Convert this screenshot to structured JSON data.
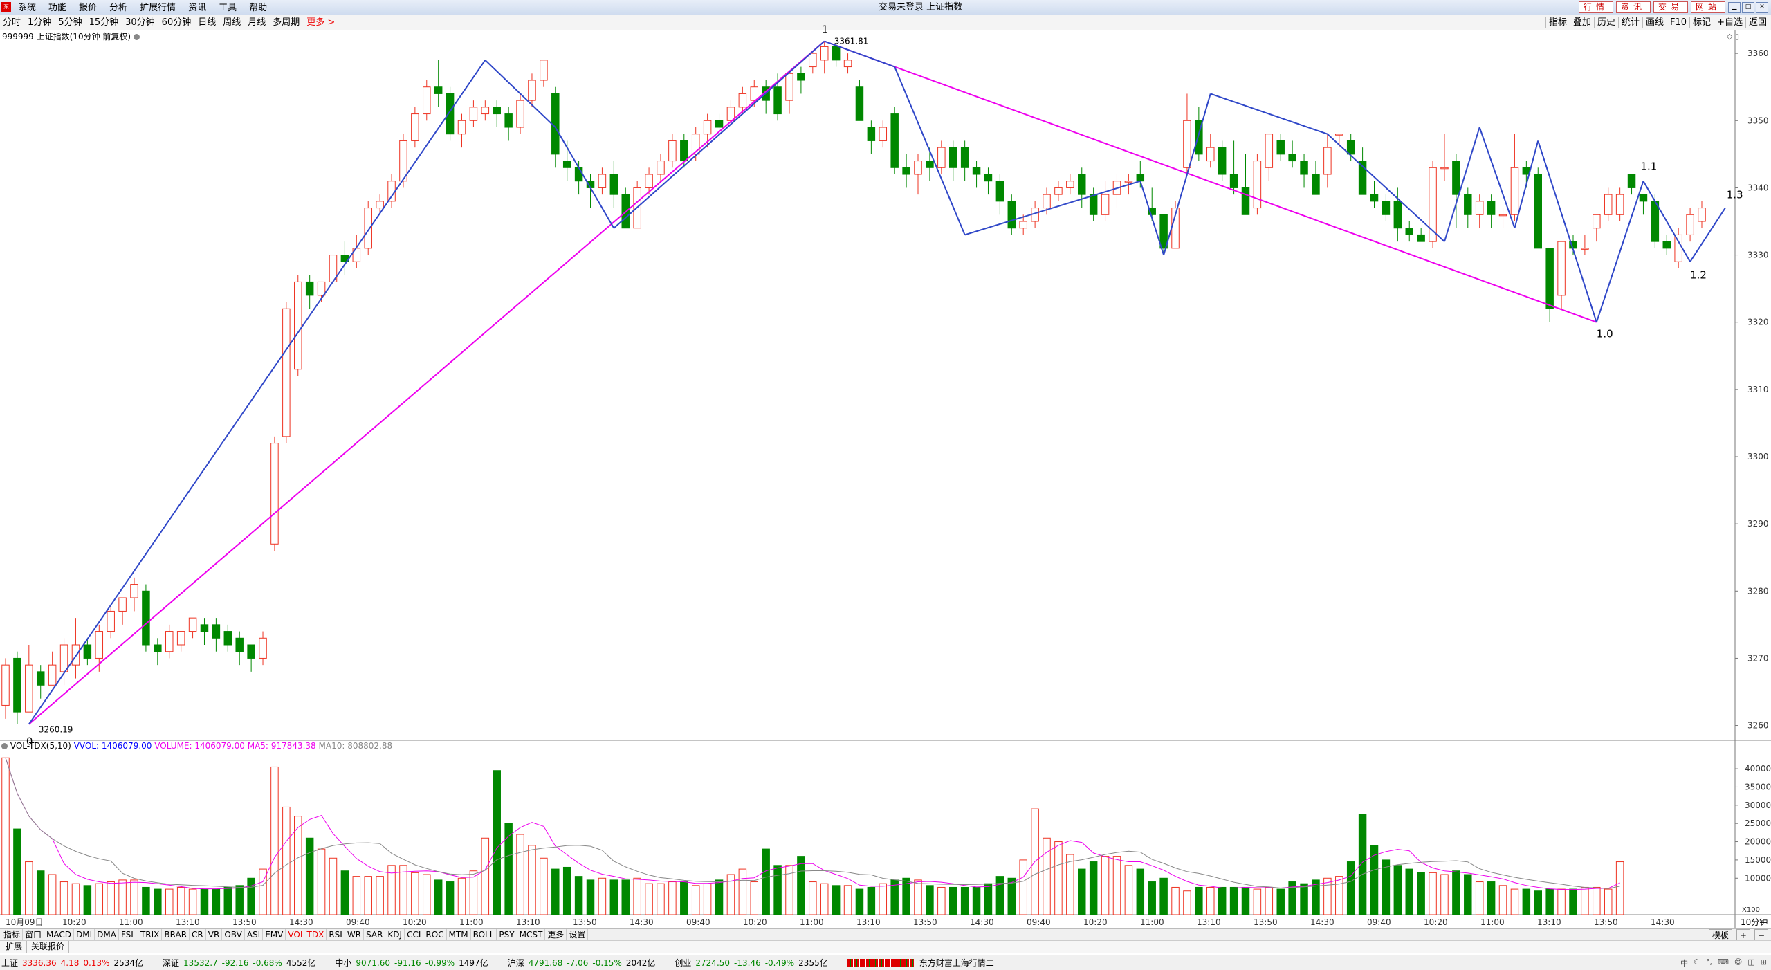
{
  "titlebar": {
    "menu": [
      "系统",
      "功能",
      "报价",
      "分析",
      "扩展行情",
      "资讯",
      "工具",
      "帮助"
    ],
    "title": "交易未登录 上证指数",
    "right_buttons": [
      "行情",
      "资讯",
      "交易",
      "网站"
    ]
  },
  "periodbar": {
    "items": [
      "分时",
      "1分钟",
      "5分钟",
      "15分钟",
      "30分钟",
      "60分钟",
      "日线",
      "周线",
      "月线",
      "多周期"
    ],
    "more": "更多 >",
    "right": [
      "指标",
      "叠加",
      "历史",
      "统计",
      "画线",
      "F10",
      "标记",
      "+自选",
      "返回"
    ]
  },
  "chart": {
    "header": "999999 上证指数(10分钟 前复权)",
    "period_label": "10分钟",
    "low_label": "3260.19",
    "high_label": "3361.81",
    "wave_labels": [
      "0",
      "1",
      "1.0",
      "1.1",
      "1.2",
      "1.3"
    ]
  },
  "indicator": {
    "name": "VOL-TDX(5,10)",
    "vvol": "VVOL: 1406079.00",
    "volume": "VOLUME: 1406079.00",
    "ma5": "MA5: 917843.38",
    "ma10": "MA10: 808802.88",
    "scale_unit": "X100"
  },
  "indbar": {
    "items": [
      "指标",
      "窗口",
      "MACD",
      "DMI",
      "DMA",
      "FSL",
      "TRIX",
      "BRAR",
      "CR",
      "VR",
      "OBV",
      "ASI",
      "EMV",
      "VOL-TDX",
      "RSI",
      "WR",
      "SAR",
      "KDJ",
      "CCI",
      "ROC",
      "MTM",
      "BOLL",
      "PSY",
      "MCST",
      "更多",
      "设置"
    ],
    "selected": "VOL-TDX",
    "right": [
      "模板",
      "+",
      "−"
    ]
  },
  "tabbar": {
    "items": [
      "扩展",
      "关联报价"
    ]
  },
  "statusbar": {
    "groups": [
      {
        "name": "上证",
        "value": "3336.36",
        "change": "4.18",
        "pct": "0.13%",
        "amount": "2534亿",
        "dir": "up"
      },
      {
        "name": "深证",
        "value": "13532.7",
        "change": "-92.16",
        "pct": "-0.68%",
        "amount": "4552亿",
        "dir": "down"
      },
      {
        "name": "中小",
        "value": "9071.60",
        "change": "-91.16",
        "pct": "-0.99%",
        "amount": "1497亿",
        "dir": "down"
      },
      {
        "name": "沪深",
        "value": "4791.68",
        "change": "-7.06",
        "pct": "-0.15%",
        "amount": "2042亿",
        "dir": "down"
      },
      {
        "name": "创业",
        "value": "2724.50",
        "change": "-13.46",
        "pct": "-0.49%",
        "amount": "2355亿",
        "dir": "down"
      }
    ],
    "marquee": "东方财富上海行情二",
    "input_mode": "中"
  },
  "chart_data": {
    "type": "candlestick",
    "y_axis": {
      "ticks": [
        3260,
        3270,
        3280,
        3290,
        3300,
        3310,
        3320,
        3330,
        3340,
        3350,
        3360
      ],
      "range": [
        3258,
        3363
      ]
    },
    "x_axis": {
      "ticks": [
        "10月09日",
        "10:20",
        "11:00",
        "13:10",
        "13:50",
        "14:30",
        "09:40",
        "10:20",
        "11:00",
        "13:10",
        "13:50",
        "14:30",
        "09:40",
        "10:20",
        "11:00",
        "13:10",
        "13:50",
        "14:30",
        "09:40",
        "10:20",
        "11:00",
        "13:10",
        "13:50",
        "14:30",
        "09:40",
        "10:20",
        "11:00",
        "13:10",
        "13:50",
        "14:30"
      ]
    },
    "candles": [
      [
        3263,
        3269,
        3261,
        3270
      ],
      [
        3270,
        3262,
        3260.19,
        3271
      ],
      [
        3262,
        3269,
        3262,
        3272
      ],
      [
        3268,
        3266,
        3264,
        3269
      ],
      [
        3266,
        3269,
        3266,
        3271
      ],
      [
        3268,
        3272,
        3266,
        3273
      ],
      [
        3269,
        3272,
        3267,
        3276
      ],
      [
        3272,
        3270,
        3269,
        3273
      ],
      [
        3270,
        3274,
        3268,
        3275
      ],
      [
        3274,
        3277,
        3273,
        3278
      ],
      [
        3277,
        3279,
        3275,
        3279
      ],
      [
        3279,
        3281,
        3277,
        3282
      ],
      [
        3280,
        3272,
        3271,
        3281
      ],
      [
        3272,
        3271,
        3269,
        3273
      ],
      [
        3271,
        3274,
        3270,
        3275
      ],
      [
        3272,
        3274,
        3271,
        3274
      ],
      [
        3274,
        3276,
        3273,
        3276
      ],
      [
        3275,
        3274,
        3272,
        3276
      ],
      [
        3275,
        3273,
        3271,
        3276
      ],
      [
        3274,
        3272,
        3271,
        3275
      ],
      [
        3273,
        3271,
        3269,
        3274
      ],
      [
        3272,
        3270,
        3268,
        3272
      ],
      [
        3270,
        3273,
        3269,
        3274
      ],
      [
        3287,
        3302,
        3286,
        3303
      ],
      [
        3303,
        3322,
        3302,
        3323
      ],
      [
        3313,
        3326,
        3312,
        3327
      ],
      [
        3326,
        3324,
        3322,
        3327
      ],
      [
        3324,
        3326,
        3323,
        3326
      ],
      [
        3326,
        3330,
        3325,
        3331
      ],
      [
        3330,
        3329,
        3327,
        3332
      ],
      [
        3329,
        3331,
        3328,
        3333
      ],
      [
        3331,
        3337,
        3330,
        3338
      ],
      [
        3337,
        3338,
        3336,
        3339
      ],
      [
        3338,
        3341,
        3337,
        3342
      ],
      [
        3341,
        3347,
        3340,
        3348
      ],
      [
        3347,
        3351,
        3346,
        3352
      ],
      [
        3351,
        3355,
        3350,
        3356
      ],
      [
        3355,
        3354,
        3352,
        3359
      ],
      [
        3354,
        3348,
        3347,
        3355
      ],
      [
        3348,
        3350,
        3346,
        3351
      ],
      [
        3350,
        3352,
        3349,
        3353
      ],
      [
        3351,
        3352,
        3350,
        3353
      ],
      [
        3352,
        3351,
        3349,
        3353
      ],
      [
        3351,
        3349,
        3347,
        3352
      ],
      [
        3349,
        3353,
        3348,
        3354
      ],
      [
        3353,
        3356,
        3352,
        3357
      ],
      [
        3356,
        3359,
        3355,
        3359
      ],
      [
        3354,
        3345,
        3343,
        3355
      ],
      [
        3344,
        3343,
        3341,
        3347
      ],
      [
        3343,
        3341,
        3339,
        3344
      ],
      [
        3341,
        3340,
        3337,
        3342
      ],
      [
        3340,
        3342,
        3339,
        3343
      ],
      [
        3342,
        3339,
        3337,
        3344
      ],
      [
        3339,
        3334,
        3334,
        3340
      ],
      [
        3334,
        3340,
        3334,
        3341
      ],
      [
        3340,
        3342,
        3339,
        3343
      ],
      [
        3342,
        3344,
        3341,
        3345
      ],
      [
        3344,
        3347,
        3343,
        3348
      ],
      [
        3347,
        3344,
        3343,
        3348
      ],
      [
        3345,
        3348,
        3344,
        3349
      ],
      [
        3348,
        3350,
        3346,
        3351
      ],
      [
        3350,
        3349,
        3347,
        3351
      ],
      [
        3350,
        3352,
        3349,
        3353
      ],
      [
        3352,
        3354,
        3351,
        3355
      ],
      [
        3353,
        3355,
        3352,
        3356
      ],
      [
        3355,
        3353,
        3351,
        3356
      ],
      [
        3355,
        3351,
        3350,
        3357
      ],
      [
        3353,
        3357,
        3351,
        3357
      ],
      [
        3357,
        3356,
        3354,
        3358
      ],
      [
        3358,
        3360,
        3357,
        3360
      ],
      [
        3359,
        3361,
        3357,
        3361.81
      ],
      [
        3361,
        3359,
        3358,
        3362
      ],
      [
        3358,
        3359,
        3357,
        3360
      ],
      [
        3355,
        3350,
        3350,
        3356
      ],
      [
        3349,
        3347,
        3345,
        3350
      ],
      [
        3347,
        3349,
        3346,
        3350
      ],
      [
        3351,
        3343,
        3342,
        3352
      ],
      [
        3343,
        3342,
        3340,
        3345
      ],
      [
        3342,
        3344,
        3339,
        3345
      ],
      [
        3344,
        3343,
        3341,
        3346
      ],
      [
        3343,
        3346,
        3342,
        3347
      ],
      [
        3346,
        3343,
        3341,
        3347
      ],
      [
        3346,
        3343,
        3341,
        3347
      ],
      [
        3343,
        3342,
        3340,
        3344
      ],
      [
        3342,
        3341,
        3339,
        3343
      ],
      [
        3341,
        3338,
        3336,
        3342
      ],
      [
        3338,
        3334,
        3333,
        3339
      ],
      [
        3334,
        3335,
        3333,
        3336
      ],
      [
        3335,
        3337,
        3334,
        3338
      ],
      [
        3337,
        3339,
        3336,
        3340
      ],
      [
        3339,
        3340,
        3338,
        3341
      ],
      [
        3340,
        3341,
        3339,
        3342
      ],
      [
        3342,
        3339,
        3337,
        3343
      ],
      [
        3339,
        3336,
        3335,
        3340
      ],
      [
        3336,
        3339,
        3335,
        3341
      ],
      [
        3339,
        3341,
        3337,
        3342
      ],
      [
        3341,
        3341,
        3339,
        3342
      ],
      [
        3342,
        3341,
        3340,
        3344
      ],
      [
        3337,
        3336,
        3335,
        3340
      ],
      [
        3336,
        3331,
        3330,
        3336
      ],
      [
        3331,
        3337,
        3331,
        3338
      ],
      [
        3343,
        3350,
        3342,
        3354
      ],
      [
        3350,
        3345,
        3344,
        3352
      ],
      [
        3344,
        3346,
        3343,
        3348
      ],
      [
        3346,
        3342,
        3341,
        3347
      ],
      [
        3342,
        3340,
        3339,
        3347
      ],
      [
        3340,
        3336,
        3337,
        3345
      ],
      [
        3337,
        3344,
        3336,
        3345
      ],
      [
        3343,
        3348,
        3341,
        3348
      ],
      [
        3347,
        3345,
        3344,
        3348
      ],
      [
        3345,
        3344,
        3343,
        3347
      ],
      [
        3344,
        3342,
        3340,
        3345
      ],
      [
        3342,
        3339,
        3339,
        3344
      ],
      [
        3342,
        3346,
        3340,
        3348
      ],
      [
        3348,
        3348,
        3346,
        3348
      ],
      [
        3347,
        3345,
        3344,
        3348
      ],
      [
        3344,
        3339,
        3339,
        3346
      ],
      [
        3339,
        3338,
        3337,
        3341
      ],
      [
        3338,
        3336,
        3335,
        3339
      ],
      [
        3338,
        3334,
        3332,
        3340
      ],
      [
        3334,
        3333,
        3332,
        3335
      ],
      [
        3333,
        3332,
        3332,
        3334
      ],
      [
        3332,
        3343,
        3331,
        3344
      ],
      [
        3343,
        3343,
        3341,
        3348
      ],
      [
        3344,
        3339,
        3334,
        3345
      ],
      [
        3339,
        3336,
        3334,
        3340
      ],
      [
        3336,
        3338,
        3334,
        3339
      ],
      [
        3338,
        3336,
        3334,
        3339
      ],
      [
        3336,
        3336,
        3334,
        3337
      ],
      [
        3336,
        3343,
        3335,
        3348
      ],
      [
        3343,
        3342,
        3340,
        3344
      ],
      [
        3342,
        3331,
        3331,
        3343
      ],
      [
        3331,
        3322,
        3320,
        3331
      ],
      [
        3324,
        3332,
        3322,
        3332
      ],
      [
        3332,
        3331,
        3330,
        3333
      ],
      [
        3331,
        3331,
        3330,
        3333
      ],
      [
        3334,
        3336,
        3332,
        3336
      ],
      [
        3336,
        3339,
        3335,
        3340
      ],
      [
        3336,
        3339,
        3335,
        3340
      ],
      [
        3342,
        3340,
        3339,
        3341
      ],
      [
        3339,
        3338,
        3336,
        3339
      ],
      [
        3338,
        3332,
        3331,
        3339
      ],
      [
        3332,
        3331,
        3330,
        3333
      ],
      [
        3329,
        3333,
        3328,
        3334
      ],
      [
        3333,
        3336,
        3332,
        3337
      ],
      [
        3335,
        3337,
        3334,
        3338
      ]
    ],
    "volume_axis": {
      "ticks": [
        10000,
        15000,
        20000,
        25000,
        30000,
        35000,
        40000
      ],
      "max": 44000
    },
    "volumes": [
      43000,
      23500,
      14500,
      12000,
      11000,
      9000,
      8500,
      8000,
      8500,
      9000,
      9500,
      9500,
      7500,
      7000,
      7000,
      7500,
      7000,
      7000,
      7000,
      7500,
      8000,
      10000,
      12500,
      40500,
      29500,
      27000,
      21000,
      18000,
      15500,
      12000,
      10500,
      10500,
      10500,
      13500,
      13500,
      11500,
      11000,
      9500,
      9000,
      10000,
      12000,
      21000,
      39500,
      25000,
      22000,
      19000,
      15500,
      12500,
      13000,
      10500,
      9500,
      10000,
      9500,
      9500,
      10000,
      8500,
      8500,
      9000,
      9000,
      8000,
      8500,
      9500,
      11000,
      12500,
      9000,
      18000,
      13500,
      13500,
      16000,
      9000,
      8500,
      8000,
      8000,
      7000,
      7500,
      8500,
      9500,
      10000,
      9500,
      8000,
      7500,
      7500,
      7500,
      7500,
      8500,
      10500,
      10000,
      15000,
      29000,
      21000,
      20000,
      16500,
      12500,
      14500,
      16000,
      16000,
      13500,
      12500,
      9000,
      10000,
      7500,
      6500,
      7500,
      7500,
      7500,
      7500,
      7500,
      7000,
      7500,
      7000,
      9000,
      8500,
      9500,
      10000,
      10500,
      14500,
      27500,
      19000,
      15000,
      13500,
      12500,
      11500,
      11500,
      11000,
      12000,
      11000,
      9000,
      9000,
      8000,
      7000,
      7000,
      6500,
      7000,
      7000,
      7000,
      7500,
      7500,
      7000,
      14500
    ],
    "wave_lines": {
      "magenta_1": {
        "from": [
          2,
          3260.19
        ],
        "to": [
          70,
          3361.81
        ]
      },
      "magenta_2": {
        "from": [
          70,
          3361.81
        ],
        "to": [
          136,
          3320
        ]
      }
    },
    "price_labels": {
      "low": "3260.19",
      "high": "3361.81"
    }
  }
}
